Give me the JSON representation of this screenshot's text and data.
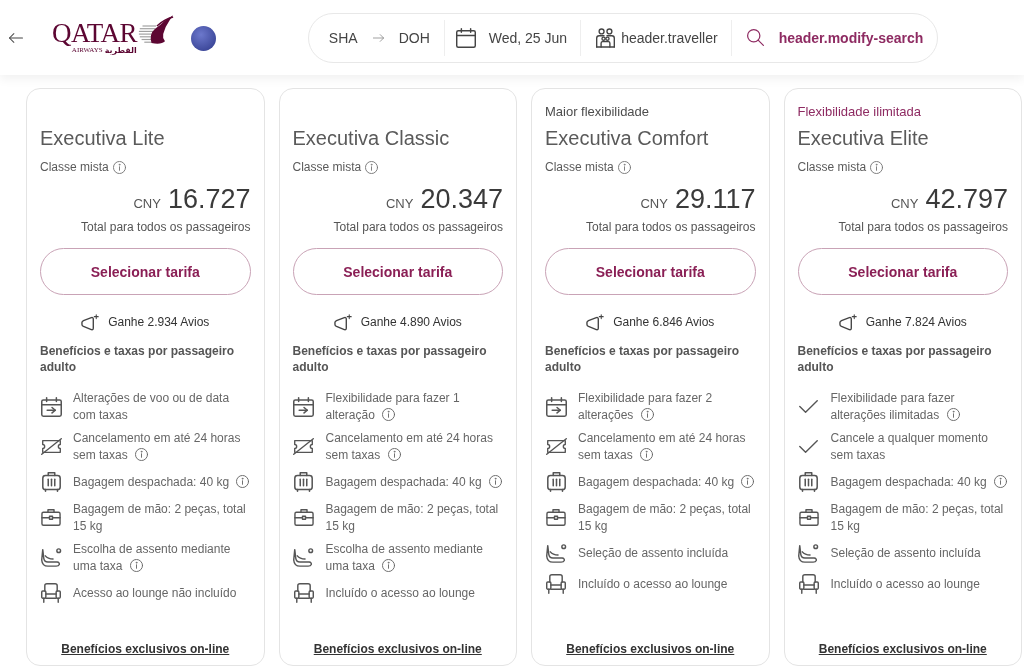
{
  "header": {
    "brand": {
      "wordmark": "QATAR",
      "subtitle": "AIRWAYS",
      "subtitle_arabic": "القطرية"
    },
    "search": {
      "origin": "SHA",
      "destination": "DOH",
      "date": "Wed, 25 Jun",
      "travellers": "header.traveller",
      "modify": "header.modify-search"
    }
  },
  "fares": [
    {
      "name": "Executiva Lite",
      "cabin": "Classe mista",
      "currency": "CNY",
      "price": "16.727",
      "price_note": "Total para todos os passageiros",
      "button": "Selecionar tarifa",
      "avios": "Ganhe 2.934 Avios",
      "benefits_title": "Benefícios e taxas por passageiro adulto",
      "features": [
        {
          "kind": "change",
          "text": "Alterações de voo ou de data com taxas",
          "info": false
        },
        {
          "kind": "cancel",
          "text": "Cancelamento em até 24 horas sem taxas",
          "info": true
        },
        {
          "kind": "checked_bag",
          "text": "Bagagem despachada: 40 kg",
          "info": true
        },
        {
          "kind": "cabin_bag",
          "text": "Bagagem de mão: 2 peças, total 15 kg",
          "info": false
        },
        {
          "kind": "seat",
          "text": "Escolha de assento mediante uma taxa",
          "info": true
        },
        {
          "kind": "lounge",
          "text": "Acesso ao lounge não incluído",
          "info": false
        }
      ],
      "link": "Benefícios exclusivos on-line"
    },
    {
      "name": "Executiva Classic",
      "cabin": "Classe mista",
      "currency": "CNY",
      "price": "20.347",
      "price_note": "Total para todos os passageiros",
      "button": "Selecionar tarifa",
      "avios": "Ganhe 4.890 Avios",
      "benefits_title": "Benefícios e taxas por passageiro adulto",
      "features": [
        {
          "kind": "change",
          "text": "Flexibilidade para fazer 1 alteração",
          "info": true
        },
        {
          "kind": "cancel",
          "text": "Cancelamento em até 24 horas sem taxas",
          "info": true
        },
        {
          "kind": "checked_bag",
          "text": "Bagagem despachada: 40 kg",
          "info": true
        },
        {
          "kind": "cabin_bag",
          "text": "Bagagem de mão: 2 peças, total 15 kg",
          "info": false
        },
        {
          "kind": "seat",
          "text": "Escolha de assento mediante uma taxa",
          "info": true
        },
        {
          "kind": "lounge",
          "text": "Incluído o acesso ao lounge",
          "info": false
        }
      ],
      "link": "Benefícios exclusivos on-line"
    },
    {
      "tag": {
        "text": "Maior flexibilidade",
        "color": "#4d4d4d"
      },
      "name": "Executiva Comfort",
      "cabin": "Classe mista",
      "currency": "CNY",
      "price": "29.117",
      "price_note": "Total para todos os passageiros",
      "button": "Selecionar tarifa",
      "avios": "Ganhe 6.846 Avios",
      "benefits_title": "Benefícios e taxas por passageiro adulto",
      "features": [
        {
          "kind": "change",
          "text": "Flexibilidade para fazer 2 alterações",
          "info": true
        },
        {
          "kind": "cancel",
          "text": "Cancelamento em até 24 horas sem taxas",
          "info": true
        },
        {
          "kind": "checked_bag",
          "text": "Bagagem despachada: 40 kg",
          "info": true
        },
        {
          "kind": "cabin_bag",
          "text": "Bagagem de mão: 2 peças, total 15 kg",
          "info": false
        },
        {
          "kind": "seat",
          "text": "Seleção de assento incluída",
          "info": false
        },
        {
          "kind": "lounge",
          "text": "Incluído o acesso ao lounge",
          "info": false
        }
      ],
      "link": "Benefícios exclusivos on-line"
    },
    {
      "tag": {
        "text": "Flexibilidade ilimitada",
        "color": "#8e2b62"
      },
      "name": "Executiva Elite",
      "cabin": "Classe mista",
      "currency": "CNY",
      "price": "42.797",
      "price_note": "Total para todos os passageiros",
      "button": "Selecionar tarifa",
      "avios": "Ganhe 7.824 Avios",
      "benefits_title": "Benefícios e taxas por passageiro adulto",
      "features": [
        {
          "kind": "check",
          "text": "Flexibilidade para fazer alterações ilimitadas",
          "info": true
        },
        {
          "kind": "check",
          "text": "Cancele a qualquer momento sem taxas",
          "info": false
        },
        {
          "kind": "checked_bag",
          "text": "Bagagem despachada: 40 kg",
          "info": true
        },
        {
          "kind": "cabin_bag",
          "text": "Bagagem de mão: 2 peças, total 15 kg",
          "info": false
        },
        {
          "kind": "seat",
          "text": "Seleção de assento incluída",
          "info": false
        },
        {
          "kind": "lounge",
          "text": "Incluído o acesso ao lounge",
          "info": false
        }
      ],
      "link": "Benefícios exclusivos on-line"
    }
  ]
}
